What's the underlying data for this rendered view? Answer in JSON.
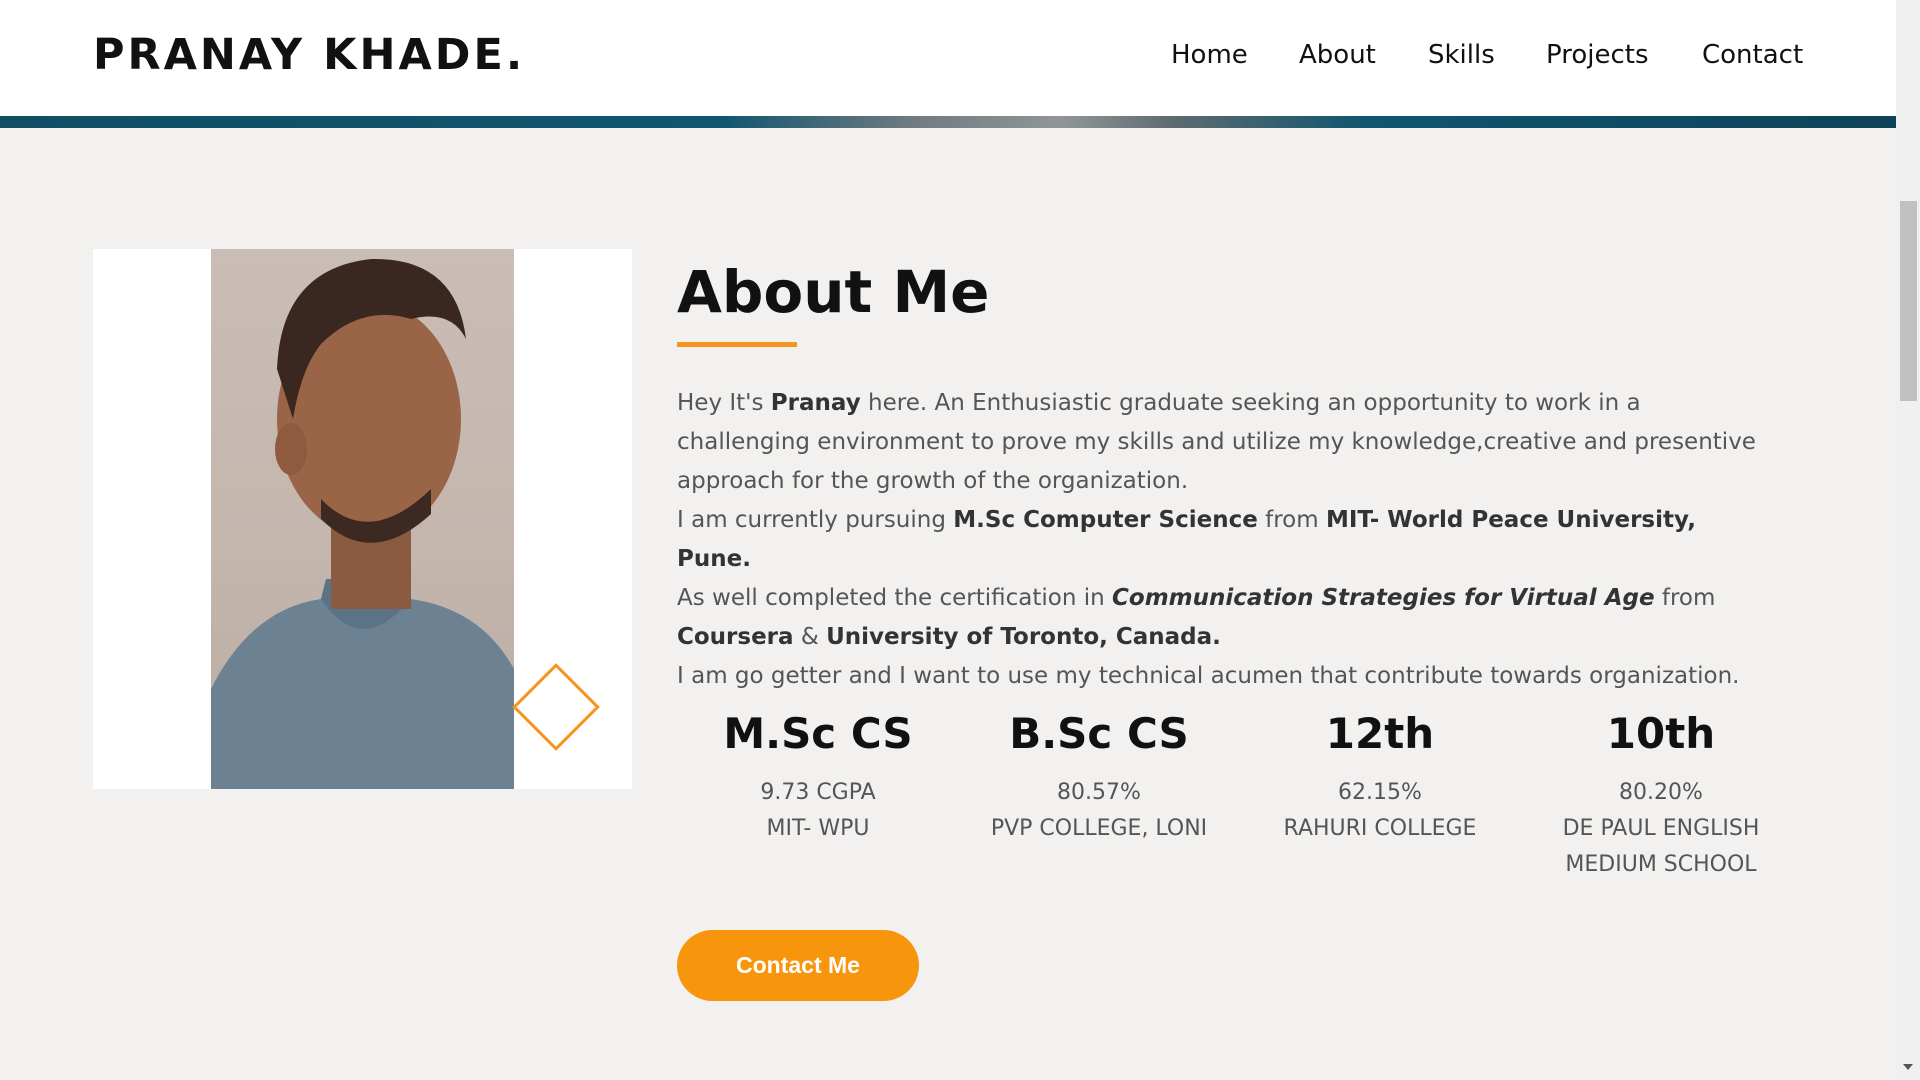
{
  "header": {
    "brand": "PRANAY KHADE.",
    "nav": [
      "Home",
      "About",
      "Skills",
      "Projects",
      "Contact"
    ]
  },
  "about": {
    "title": "About Me",
    "intro_1": "Hey It's ",
    "name": "Pranay",
    "intro_2": " here. An Enthusiastic graduate seeking an opportunity to work in a challenging environment to prove my skills and utilize my knowledge,creative and presentive approach for the growth of the organization.",
    "pursuing_1": "I am currently pursuing ",
    "degree": "M.Sc Computer Science",
    "pursuing_2": " from ",
    "university": "MIT- World Peace University, Pune.",
    "cert_1": "As well completed the certification in ",
    "cert_course": "Communication Strategies for Virtual Age",
    "cert_2": " from ",
    "cert_org": "Coursera",
    "cert_3": " & ",
    "cert_uni": "University of Toronto, Canada.",
    "closing": "I am go getter and I want to use my technical acumen that contribute towards organization."
  },
  "stats": [
    {
      "title": "M.Sc CS",
      "score": "9.73 CGPA",
      "place": "MIT- WPU"
    },
    {
      "title": "B.Sc CS",
      "score": "80.57%",
      "place": "PVP COLLEGE, LONI"
    },
    {
      "title": "12th",
      "score": "62.15%",
      "place": "RAHURI COLLEGE"
    },
    {
      "title": "10th",
      "score": "80.20%",
      "place": "DE PAUL ENGLISH MEDIUM SCHOOL"
    }
  ],
  "cta": {
    "label": "Contact Me"
  },
  "colors": {
    "accent": "#f7941d",
    "banner": "#0f5670"
  }
}
